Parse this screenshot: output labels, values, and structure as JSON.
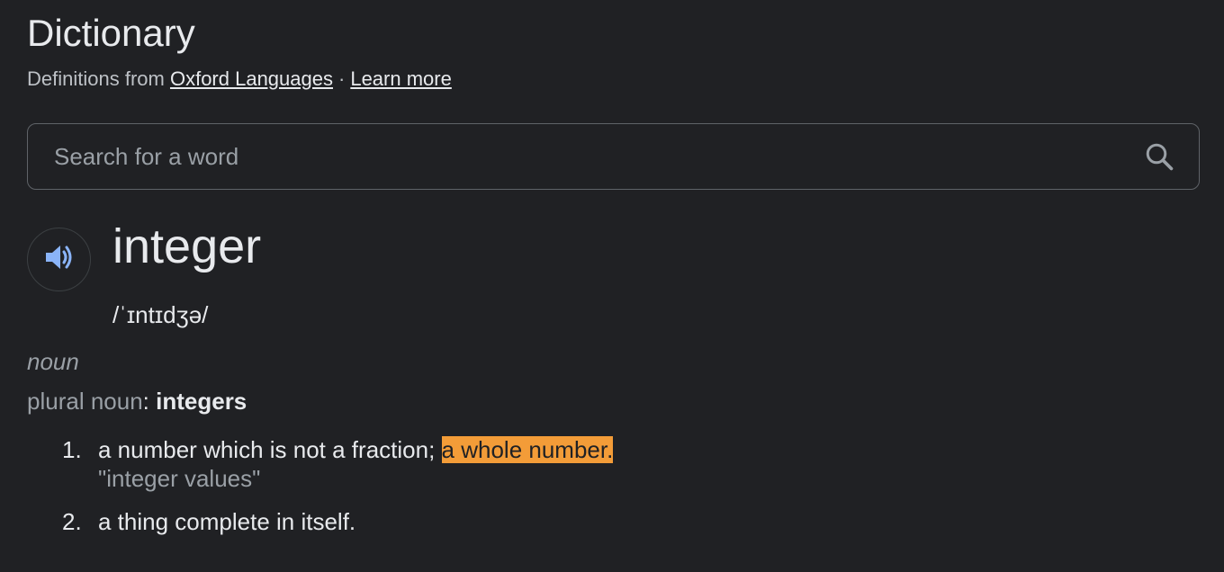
{
  "dictionary": {
    "title": "Dictionary",
    "source_prefix": "Definitions from",
    "source_link": "Oxford Languages",
    "separator": "·",
    "learn_more": "Learn more"
  },
  "search": {
    "placeholder": "Search for a word",
    "value": "",
    "icon": "search-icon"
  },
  "entry": {
    "audio_icon": "speaker-icon",
    "word": "integer",
    "phonetic": "/ˈɪntɪdʒə/",
    "part_of_speech": "noun",
    "plural_label": "plural noun",
    "plural_colon": ":",
    "plural_value": "integers",
    "definitions": [
      {
        "number": "1.",
        "text": "a number which is not a fraction;",
        "highlight": "a whole number.",
        "example": "\"integer values\""
      },
      {
        "number": "2.",
        "text": "a thing complete in itself."
      }
    ]
  },
  "colors": {
    "background": "#202124",
    "text": "#e8eaed",
    "muted": "#9aa0a6",
    "highlight": "#f39c38",
    "audio_icon": "#8ab4f8"
  }
}
